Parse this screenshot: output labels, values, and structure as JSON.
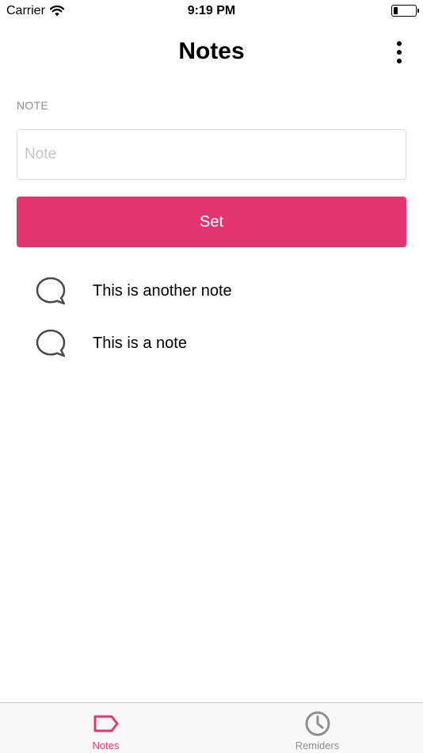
{
  "status_bar": {
    "carrier": "Carrier",
    "time": "9:19 PM",
    "battery_level": 0.2
  },
  "nav": {
    "title": "Notes",
    "more_icon": "more-vertical-icon"
  },
  "form": {
    "label": "NOTE",
    "input_value": "",
    "input_placeholder": "Note",
    "submit_label": "Set"
  },
  "notes": [
    {
      "text": "This is another note",
      "icon": "speech-bubble-icon"
    },
    {
      "text": "This is a note",
      "icon": "speech-bubble-icon"
    }
  ],
  "tabs": [
    {
      "label": "Notes",
      "icon": "tag-icon",
      "active": true
    },
    {
      "label": "Remiders",
      "icon": "clock-icon",
      "active": false
    }
  ],
  "colors": {
    "accent": "#e33671",
    "inactive_tab": "#8e8e93",
    "label_gray": "#8e8e93"
  }
}
